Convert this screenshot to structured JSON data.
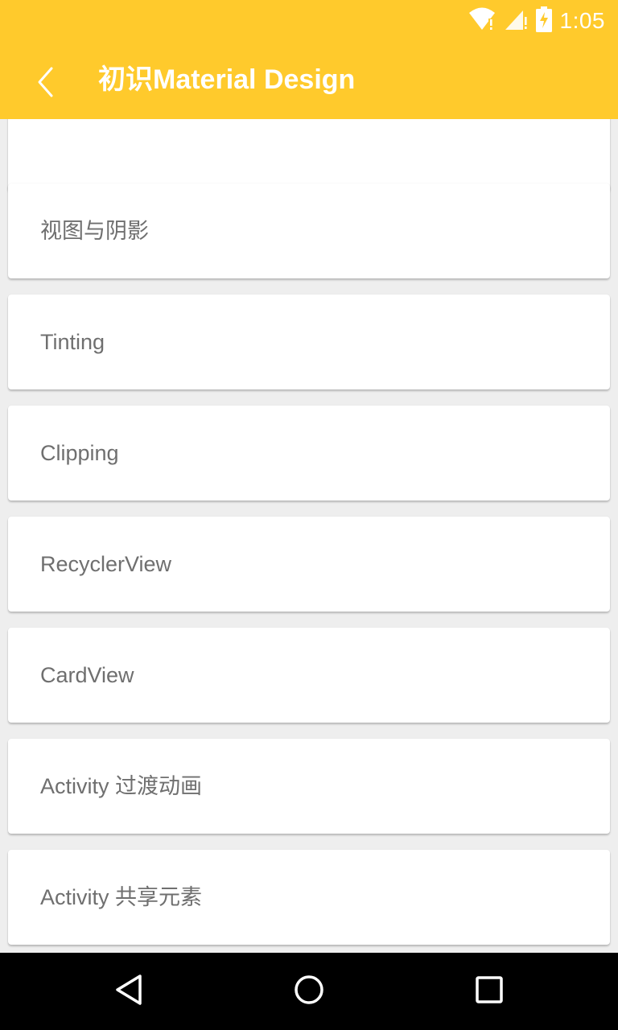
{
  "status_bar": {
    "time": "1:05",
    "icons": [
      "wifi-icon",
      "cell-signal-icon",
      "battery-charging-icon"
    ]
  },
  "toolbar": {
    "title": "初识Material Design",
    "back_icon": "back-chevron-icon",
    "background_color": "#FFCA2C",
    "text_color": "#FFFFFF"
  },
  "list": {
    "items": [
      {
        "label": ""
      },
      {
        "label": "视图与阴影"
      },
      {
        "label": "Tinting"
      },
      {
        "label": "Clipping"
      },
      {
        "label": "RecyclerView"
      },
      {
        "label": "CardView"
      },
      {
        "label": "Activity 过渡动画"
      },
      {
        "label": "Activity 共享元素"
      }
    ]
  },
  "nav_bar": {
    "buttons": [
      "back-triangle-icon",
      "home-circle-icon",
      "recents-square-icon"
    ]
  }
}
